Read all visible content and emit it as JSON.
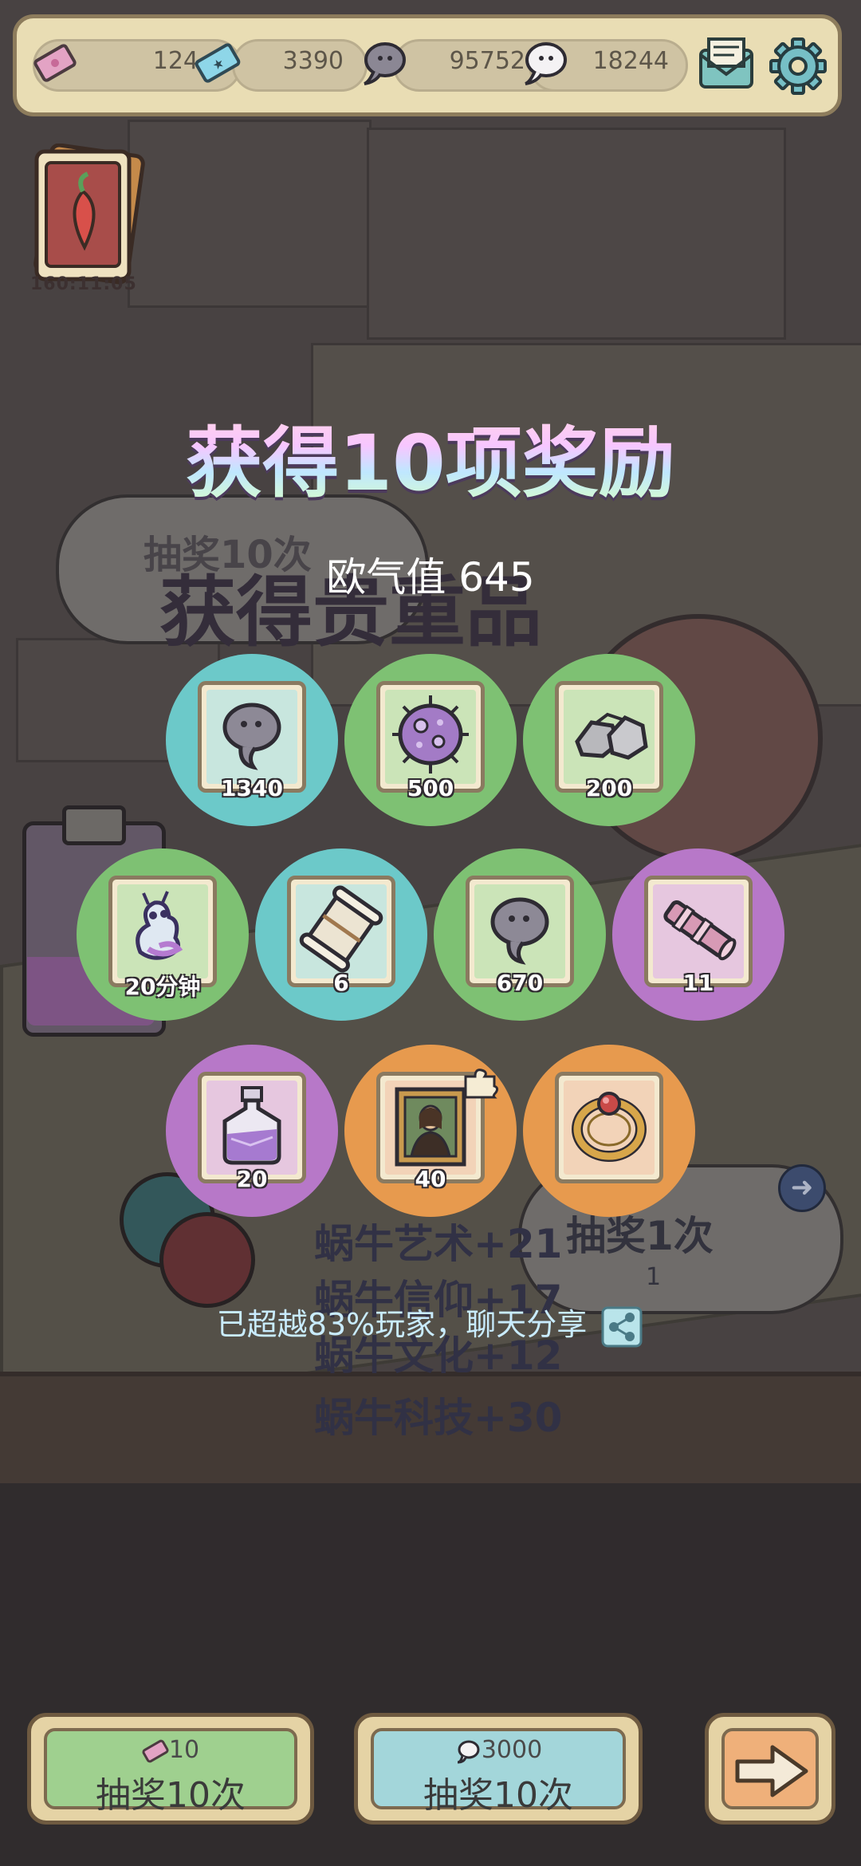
{
  "topbar": {
    "resources": [
      {
        "name": "ticket",
        "value": "124"
      },
      {
        "name": "blue-ticket",
        "value": "3390"
      },
      {
        "name": "dark-tadpole",
        "value": "95752"
      },
      {
        "name": "white-tadpole",
        "value": "18244"
      }
    ],
    "mail_icon": "mail-icon",
    "settings_icon": "gear-icon"
  },
  "event": {
    "timer": "160:11:05",
    "icon": "chili-pepper-card-icon"
  },
  "result": {
    "title": "获得10项奖励",
    "luck_label": "欧气值 645",
    "share_text": "已超越83%玩家，聊天分享"
  },
  "rewards": [
    {
      "item": "dark-tadpole-icon",
      "qty": "1340",
      "ring": "#6cc9c9"
    },
    {
      "item": "purple-germ-icon",
      "qty": "500",
      "ring": "#7ec173"
    },
    {
      "item": "stone-pile-icon",
      "qty": "200",
      "ring": "#7ec173"
    },
    {
      "item": "snail-timer-icon",
      "qty": "20分钟",
      "ring": "#7ec173"
    },
    {
      "item": "scroll-icon",
      "qty": "6",
      "ring": "#6cc9c9"
    },
    {
      "item": "dark-tadpole-icon",
      "qty": "670",
      "ring": "#7ec173"
    },
    {
      "item": "telescope-icon",
      "qty": "11",
      "ring": "#b778c8"
    },
    {
      "item": "purple-potion-icon",
      "qty": "20",
      "ring": "#b778c8"
    },
    {
      "item": "mona-lisa-painting-icon",
      "qty": "40",
      "ring": "#e79a4e"
    },
    {
      "item": "gold-ring-icon",
      "qty": "",
      "ring": "#e79a4e"
    }
  ],
  "buttons": {
    "draw_ticket": {
      "cost": "10",
      "label": "抽奖10次"
    },
    "draw_tadpole": {
      "cost": "3000",
      "label": "抽奖10次"
    },
    "next_icon": "arrow-right-icon"
  },
  "background_text": {
    "left_banner": "抽奖10次",
    "rare_banner": "获得贵重品",
    "stats": [
      "蜗牛艺术+21",
      "蜗牛信仰+17",
      "蜗牛文化+12",
      "蜗牛科技+30"
    ],
    "right_banner": "抽奖1次",
    "right_cost": "1"
  }
}
